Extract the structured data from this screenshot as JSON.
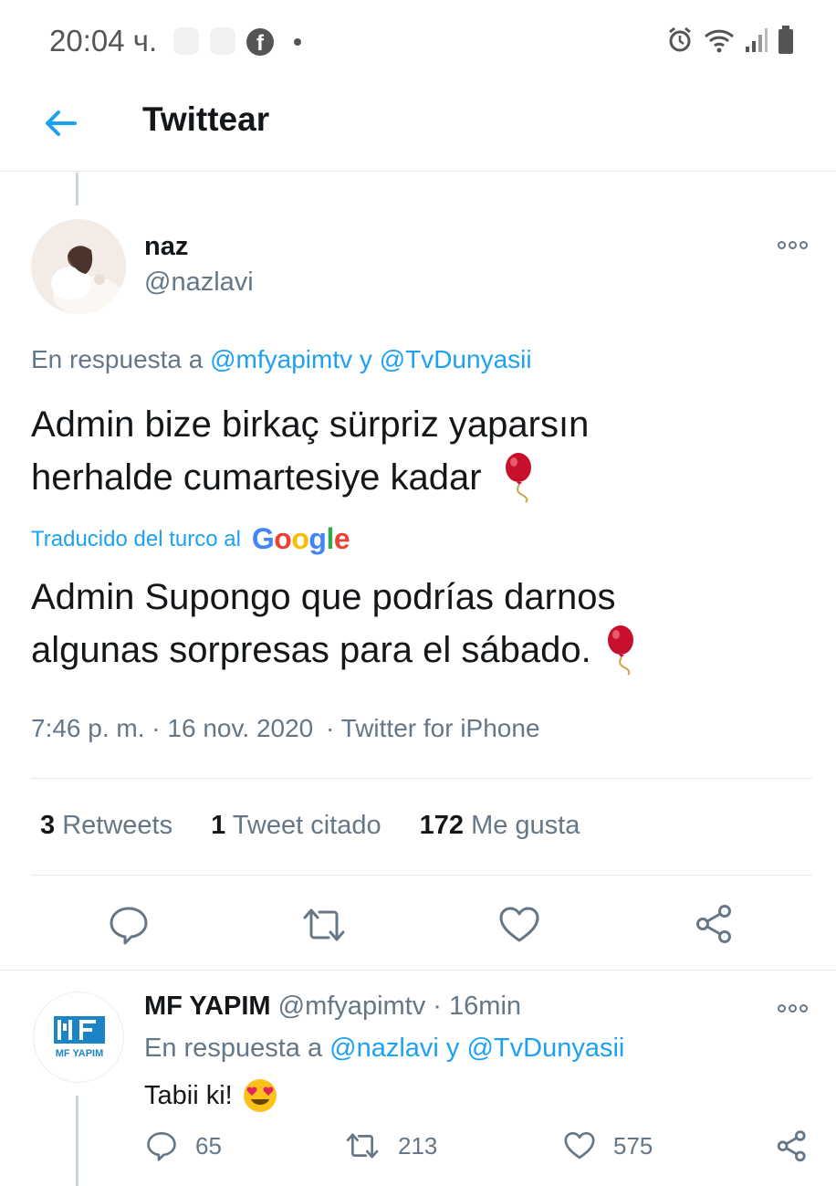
{
  "status_bar": {
    "time": "20:04 ч.",
    "icons": [
      "facebook-icon",
      "alarm-icon",
      "wifi-icon",
      "signal-icon",
      "battery-icon"
    ]
  },
  "header": {
    "title": "Twittear",
    "back_icon": "arrow-left-icon"
  },
  "main_tweet": {
    "name": "naz",
    "handle": "@nazlavi",
    "reply_prefix": "En respuesta a",
    "reply_mention_1": "@mfyapimtv",
    "reply_joiner": "y",
    "reply_mention_2": "@TvDunyasii",
    "text_line_1": "Admin bize birkaç sürpriz yaparsın",
    "text_line_2": "herhalde cumartesiye kadar",
    "translated_by": "Traducido del turco al",
    "translated_line_1": "Admin Supongo que podrías darnos",
    "translated_line_2": "algunas sorpresas para el sábado.",
    "time": "7:46 p. m.",
    "date": "16 nov. 2020",
    "source": "Twitter for iPhone",
    "sep": "·",
    "retweets_count": "3",
    "retweets_label": "Retweets",
    "quotes_count": "1",
    "quotes_label": "Tweet citado",
    "likes_count": "172",
    "likes_label": "Me gusta"
  },
  "google_logo": {
    "letters": [
      "G",
      "o",
      "o",
      "g",
      "l",
      "e"
    ],
    "colors": [
      "#4285f4",
      "#ea4335",
      "#fbbc05",
      "#4285f4",
      "#34a853",
      "#ea4335"
    ]
  },
  "reply_tweet": {
    "name": "MF YAPIM",
    "handle": "@mfyapimtv",
    "sep": "·",
    "age": "16min",
    "reply_prefix": "En respuesta a",
    "reply_mention_1": "@nazlavi",
    "reply_joiner": "y",
    "reply_mention_2": "@TvDunyasii",
    "text": "Tabii ki!",
    "replies": "65",
    "retweets": "213",
    "likes": "575",
    "logo_text": "MF YAPIM"
  },
  "colors": {
    "accent": "#1da1f2",
    "muted": "#657786",
    "text": "#14171a"
  }
}
